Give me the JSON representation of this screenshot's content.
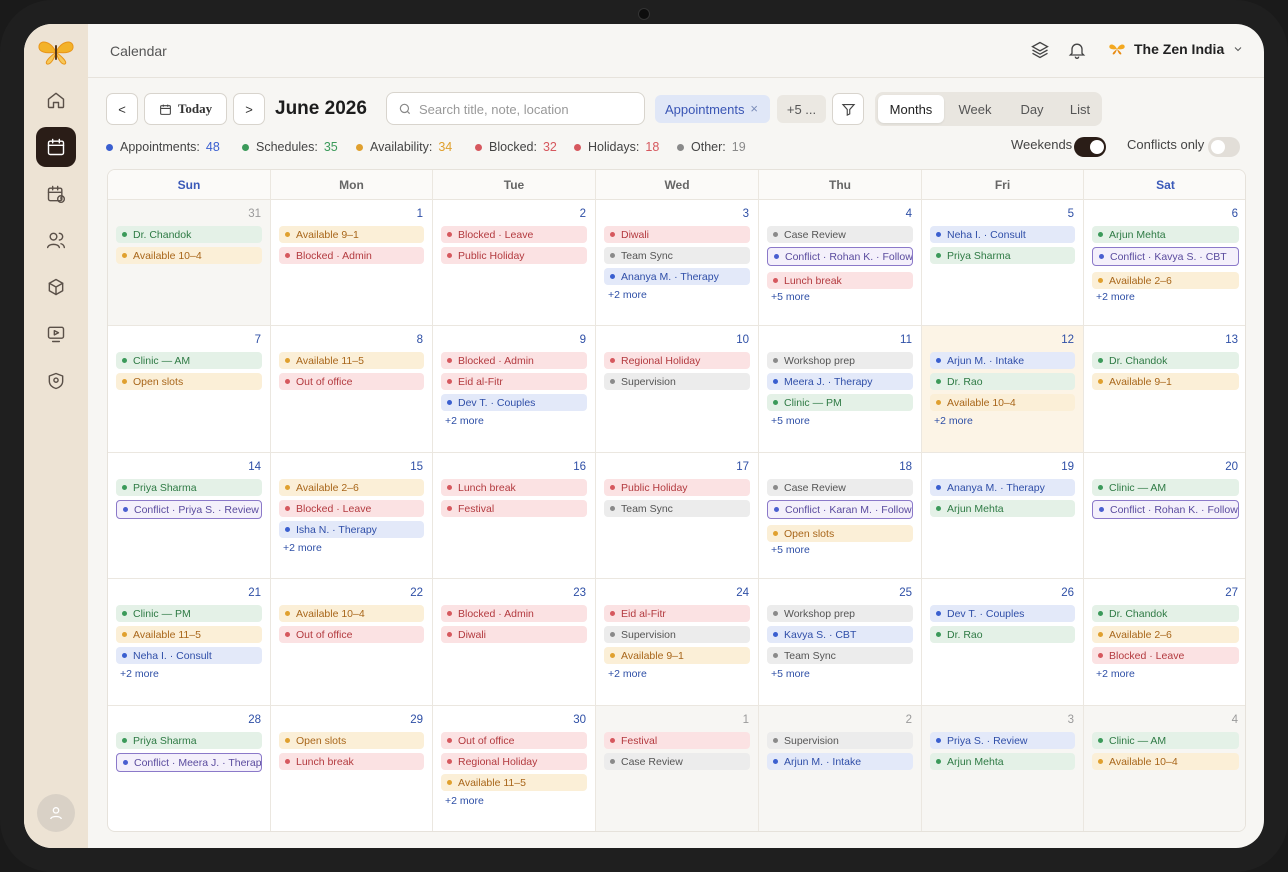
{
  "app": {
    "page_title": "Calendar",
    "org_name": "The Zen India"
  },
  "sidebar": {
    "items": [
      {
        "icon": "home-icon"
      },
      {
        "icon": "calendar-icon",
        "active": true
      },
      {
        "icon": "schedule-icon"
      },
      {
        "icon": "users-icon"
      },
      {
        "icon": "box-icon"
      },
      {
        "icon": "video-icon"
      },
      {
        "icon": "shield-icon"
      }
    ]
  },
  "toolbar": {
    "prev_label": "<",
    "today_label": "Today",
    "next_label": ">",
    "month_title": "June 2026",
    "search_placeholder": "Search title, note, location",
    "active_filter": "Appointments",
    "active_filter_remove": "×",
    "more_filters": "+5 ...",
    "views": [
      "Months",
      "Week",
      "Day",
      "List"
    ],
    "active_view": "Months"
  },
  "legend": [
    {
      "label": "Appointments:",
      "count": "48",
      "color": "#3a5fd0"
    },
    {
      "label": "Schedules:",
      "count": "35",
      "color": "#3b9a5a"
    },
    {
      "label": "Availability:",
      "count": "34",
      "color": "#e0a02e"
    },
    {
      "label": "Blocked:",
      "count": "32",
      "color": "#d6585e"
    },
    {
      "label": "Holidays:",
      "count": "18",
      "color": "#d6585e"
    },
    {
      "label": "Other:",
      "count": "19",
      "color": "#8a8a8a"
    }
  ],
  "toggles": {
    "weekends_label": "Weekends",
    "weekends_on": true,
    "conflicts_label": "Conflicts only",
    "conflicts_on": false
  },
  "calendar": {
    "weekdays": [
      "Sun",
      "Mon",
      "Tue",
      "Wed",
      "Thu",
      "Fri",
      "Sat"
    ],
    "weeks": [
      [
        {
          "day": "31",
          "muted": true,
          "events": [
            [
              "green",
              "Dr. Chandok"
            ],
            [
              "amber",
              "Available 10–4"
            ]
          ]
        },
        {
          "day": "1",
          "events": [
            [
              "amber",
              "Available 9–1"
            ],
            [
              "red",
              "Blocked · Admin"
            ]
          ]
        },
        {
          "day": "2",
          "events": [
            [
              "red",
              "Blocked · Leave"
            ],
            [
              "red",
              "Public Holiday"
            ]
          ]
        },
        {
          "day": "3",
          "events": [
            [
              "red",
              "Diwali"
            ],
            [
              "gray",
              "Team Sync"
            ],
            [
              "blue",
              "Ananya M. · Therapy"
            ]
          ],
          "more": "+2 more"
        },
        {
          "day": "4",
          "events": [
            [
              "gray",
              "Case Review"
            ],
            [
              "purple",
              "Conflict · Rohan K. · Follow-up"
            ],
            [
              "red",
              "Lunch break"
            ]
          ],
          "more": "+5 more"
        },
        {
          "day": "5",
          "events": [
            [
              "blue",
              "Neha I. · Consult"
            ],
            [
              "green",
              "Priya Sharma"
            ]
          ]
        },
        {
          "day": "6",
          "events": [
            [
              "green",
              "Arjun Mehta"
            ],
            [
              "purple",
              "Conflict · Kavya S. · CBT"
            ],
            [
              "amber",
              "Available 2–6"
            ]
          ],
          "more": "+2 more"
        }
      ],
      [
        {
          "day": "7",
          "events": [
            [
              "green",
              "Clinic — AM"
            ],
            [
              "amber",
              "Open slots"
            ]
          ]
        },
        {
          "day": "8",
          "events": [
            [
              "amber",
              "Available 11–5"
            ],
            [
              "red",
              "Out of office"
            ]
          ]
        },
        {
          "day": "9",
          "events": [
            [
              "red",
              "Blocked · Admin"
            ],
            [
              "red",
              "Eid al-Fitr"
            ],
            [
              "blue",
              "Dev T. · Couples"
            ]
          ],
          "more": "+2 more"
        },
        {
          "day": "10",
          "events": [
            [
              "red",
              "Regional Holiday"
            ],
            [
              "gray",
              "Supervision"
            ]
          ]
        },
        {
          "day": "11",
          "events": [
            [
              "gray",
              "Workshop prep"
            ],
            [
              "blue",
              "Meera J. · Therapy"
            ],
            [
              "green",
              "Clinic — PM"
            ]
          ],
          "more": "+5 more"
        },
        {
          "day": "12",
          "today": true,
          "events": [
            [
              "blue",
              "Arjun M. · Intake"
            ],
            [
              "green",
              "Dr. Rao"
            ],
            [
              "amber",
              "Available 10–4"
            ]
          ],
          "more": "+2 more"
        },
        {
          "day": "13",
          "events": [
            [
              "green",
              "Dr. Chandok"
            ],
            [
              "amber",
              "Available 9–1"
            ]
          ]
        }
      ],
      [
        {
          "day": "14",
          "events": [
            [
              "green",
              "Priya Sharma"
            ],
            [
              "purple",
              "Conflict · Priya S. · Review"
            ]
          ]
        },
        {
          "day": "15",
          "events": [
            [
              "amber",
              "Available 2–6"
            ],
            [
              "red",
              "Blocked · Leave"
            ],
            [
              "blue",
              "Isha N. · Therapy"
            ]
          ],
          "more": "+2 more"
        },
        {
          "day": "16",
          "events": [
            [
              "red",
              "Lunch break"
            ],
            [
              "red",
              "Festival"
            ]
          ]
        },
        {
          "day": "17",
          "events": [
            [
              "red",
              "Public Holiday"
            ],
            [
              "gray",
              "Team Sync"
            ]
          ]
        },
        {
          "day": "18",
          "events": [
            [
              "gray",
              "Case Review"
            ],
            [
              "purple",
              "Conflict · Karan M. · Follow-up"
            ],
            [
              "amber",
              "Open slots"
            ]
          ],
          "more": "+5 more"
        },
        {
          "day": "19",
          "events": [
            [
              "blue",
              "Ananya M. · Therapy"
            ],
            [
              "green",
              "Arjun Mehta"
            ]
          ]
        },
        {
          "day": "20",
          "events": [
            [
              "green",
              "Clinic — AM"
            ],
            [
              "purple",
              "Conflict · Rohan K. · Follow-up"
            ]
          ]
        }
      ],
      [
        {
          "day": "21",
          "events": [
            [
              "green",
              "Clinic — PM"
            ],
            [
              "amber",
              "Available 11–5"
            ],
            [
              "blue",
              "Neha I. · Consult"
            ]
          ],
          "more": "+2 more"
        },
        {
          "day": "22",
          "events": [
            [
              "amber",
              "Available 10–4"
            ],
            [
              "red",
              "Out of office"
            ]
          ]
        },
        {
          "day": "23",
          "events": [
            [
              "red",
              "Blocked · Admin"
            ],
            [
              "red",
              "Diwali"
            ]
          ]
        },
        {
          "day": "24",
          "events": [
            [
              "red",
              "Eid al-Fitr"
            ],
            [
              "gray",
              "Supervision"
            ],
            [
              "amber",
              "Available 9–1"
            ]
          ],
          "more": "+2 more"
        },
        {
          "day": "25",
          "events": [
            [
              "gray",
              "Workshop prep"
            ],
            [
              "blue",
              "Kavya S. · CBT"
            ],
            [
              "gray",
              "Team Sync"
            ]
          ],
          "more": "+5 more"
        },
        {
          "day": "26",
          "events": [
            [
              "blue",
              "Dev T. · Couples"
            ],
            [
              "green",
              "Dr. Rao"
            ]
          ]
        },
        {
          "day": "27",
          "events": [
            [
              "green",
              "Dr. Chandok"
            ],
            [
              "amber",
              "Available 2–6"
            ],
            [
              "red",
              "Blocked · Leave"
            ]
          ],
          "more": "+2 more"
        }
      ],
      [
        {
          "day": "28",
          "events": [
            [
              "green",
              "Priya Sharma"
            ],
            [
              "purple",
              "Conflict · Meera J. · Therapy"
            ]
          ]
        },
        {
          "day": "29",
          "events": [
            [
              "amber",
              "Open slots"
            ],
            [
              "red",
              "Lunch break"
            ]
          ]
        },
        {
          "day": "30",
          "events": [
            [
              "red",
              "Out of office"
            ],
            [
              "red",
              "Regional Holiday"
            ],
            [
              "amber",
              "Available 11–5"
            ]
          ],
          "more": "+2 more"
        },
        {
          "day": "1",
          "muted": true,
          "events": [
            [
              "red",
              "Festival"
            ],
            [
              "gray",
              "Case Review"
            ]
          ]
        },
        {
          "day": "2",
          "muted": true,
          "events": [
            [
              "gray",
              "Supervision"
            ],
            [
              "blue",
              "Arjun M. · Intake"
            ]
          ]
        },
        {
          "day": "3",
          "muted": true,
          "events": [
            [
              "blue",
              "Priya S. · Review"
            ],
            [
              "green",
              "Arjun Mehta"
            ]
          ]
        },
        {
          "day": "4",
          "muted": true,
          "events": [
            [
              "green",
              "Clinic — AM"
            ],
            [
              "amber",
              "Available 10–4"
            ]
          ]
        }
      ]
    ]
  }
}
